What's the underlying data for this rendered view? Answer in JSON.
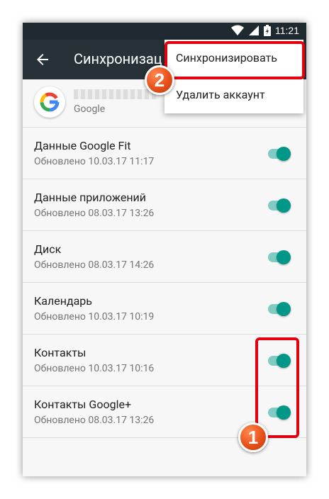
{
  "status_bar": {
    "time": "11:21",
    "icons": [
      "wifi-icon",
      "signal-icon",
      "battery-icon"
    ]
  },
  "app_bar": {
    "title": "Синхронизац",
    "back_icon": "arrow-back-icon"
  },
  "account": {
    "provider_logo": "google-logo-icon",
    "type_label": "Google"
  },
  "sync_items": [
    {
      "title": "Данные Google Fit",
      "subtitle": "Обновлено 10.03.17 11:17",
      "enabled": true
    },
    {
      "title": "Данные приложений",
      "subtitle": "Обновлено 08.03.17 13:26",
      "enabled": true
    },
    {
      "title": "Диск",
      "subtitle": "Обновлено 08.03.17 14:26",
      "enabled": true
    },
    {
      "title": "Календарь",
      "subtitle": "Обновлено 10.03.17 10:19",
      "enabled": true
    },
    {
      "title": "Контакты",
      "subtitle": "Обновлено 10.03.17 10:16",
      "enabled": true
    },
    {
      "title": "Контакты Google+",
      "subtitle": "Обновлено 08.03.17 13:26",
      "enabled": true
    }
  ],
  "overflow_menu": {
    "items": [
      "Синхронизировать",
      "Удалить аккаунт"
    ]
  },
  "annotations": {
    "badge_1": "1",
    "badge_2": "2",
    "highlight_color": "#e3000f",
    "badge_color": "#e8501a"
  },
  "colors": {
    "app_bar": "#263238",
    "status_bar": "#1f2a30",
    "toggle_on": "#009688",
    "toggle_track": "#80cbc4"
  }
}
